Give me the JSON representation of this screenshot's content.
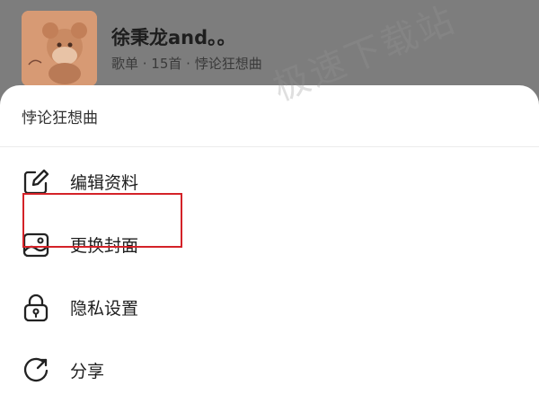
{
  "playlist": {
    "title": "徐秉龙and。。",
    "subtitle": "歌单 · 15首 · 悖论狂想曲"
  },
  "sheet": {
    "header": "悖论狂想曲",
    "items": [
      {
        "label": "编辑资料",
        "icon": "edit-icon"
      },
      {
        "label": "更换封面",
        "icon": "image-icon"
      },
      {
        "label": "隐私设置",
        "icon": "lock-icon"
      },
      {
        "label": "分享",
        "icon": "share-icon"
      }
    ]
  },
  "watermark": "极速下载站",
  "colors": {
    "highlight": "#d42228",
    "backdrop": "#7d7d7d"
  }
}
